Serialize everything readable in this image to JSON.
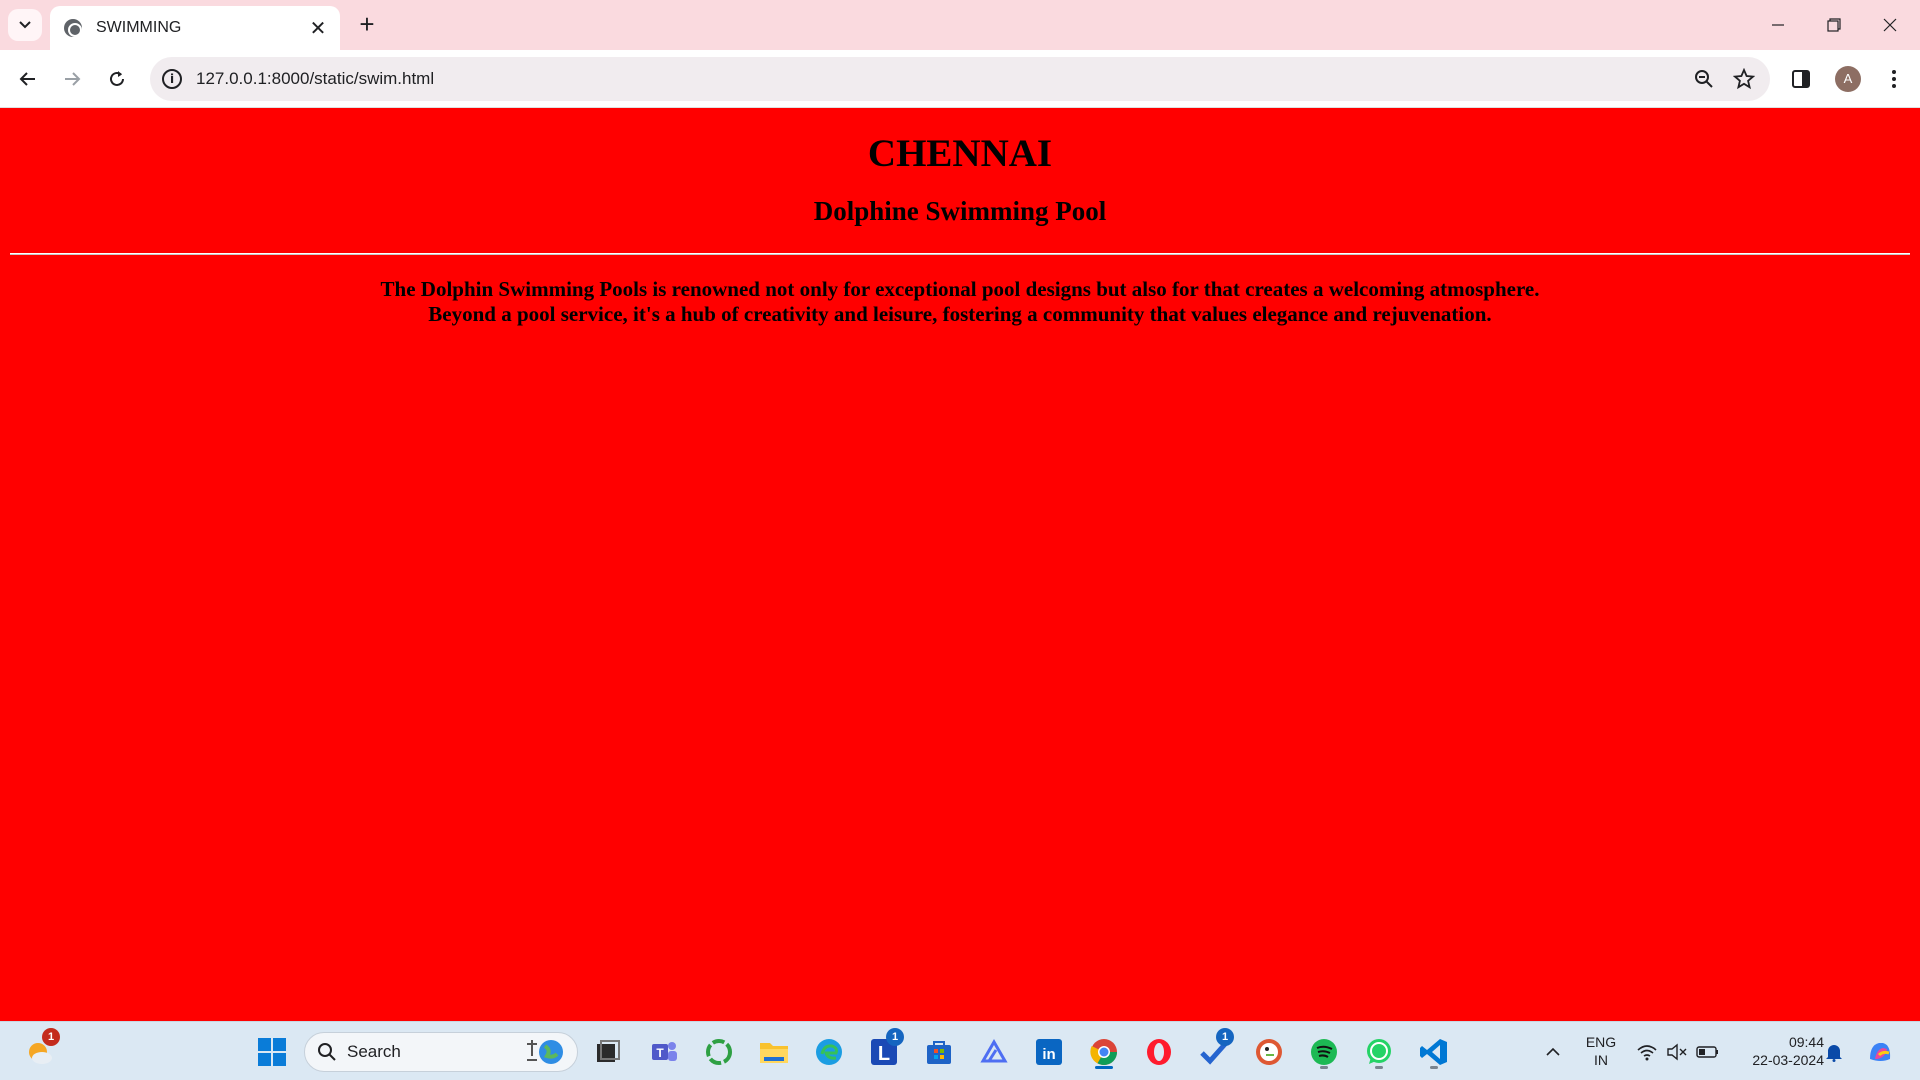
{
  "browser": {
    "tab": {
      "title": "SWIMMING",
      "close": "✕"
    },
    "new_tab": "+",
    "address": "127.0.0.1:8000/static/swim.html",
    "profile_initial": "A"
  },
  "page": {
    "heading": "CHENNAI",
    "subheading": "Dolphine Swimming Pool",
    "paragraph_line1": "The Dolphin Swimming Pools is renowned not only for exceptional pool designs but also for that creates a welcoming atmosphere.",
    "paragraph_line2": "Beyond a pool service, it's a hub of creativity and leisure, fostering a community that values elegance and rejuvenation.",
    "background_color": "#ff0000"
  },
  "taskbar": {
    "search_placeholder": "Search",
    "weather_badge": "1",
    "lens_badge": "1",
    "todo_badge": "1",
    "language_line1": "ENG",
    "language_line2": "IN",
    "time": "09:44",
    "date": "22-03-2024",
    "apps": [
      "start-icon",
      "task-view-icon",
      "teams-icon",
      "cycle-app-icon",
      "file-explorer-icon",
      "edge-icon",
      "lens-icon",
      "store-icon",
      "arc-icon",
      "linkedin-icon",
      "chrome-icon",
      "opera-icon",
      "todo-icon",
      "duckduckgo-icon",
      "spotify-icon",
      "whatsapp-icon",
      "vscode-icon"
    ]
  }
}
